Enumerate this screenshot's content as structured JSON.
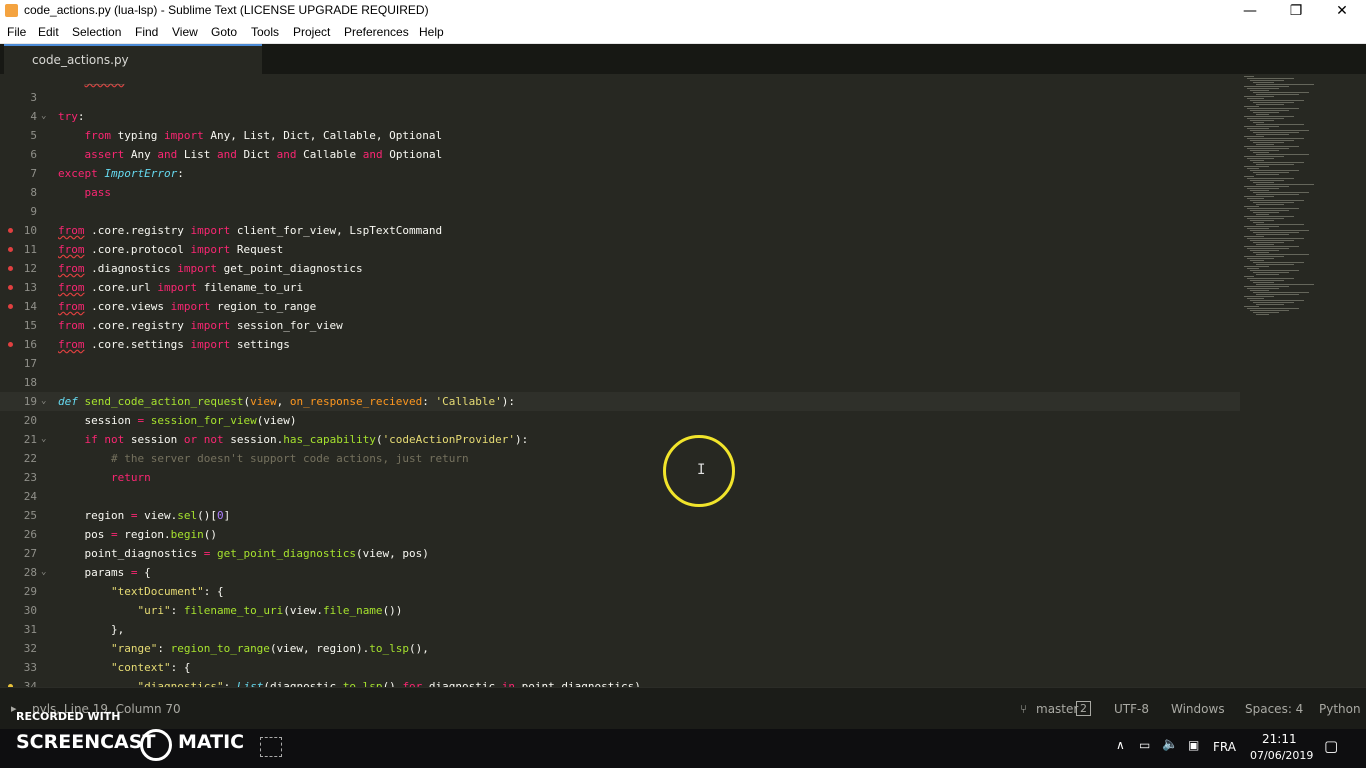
{
  "window": {
    "title": "code_actions.py (lua-lsp) - Sublime Text (LICENSE UPGRADE REQUIRED)",
    "minimize": "—",
    "restore": "❐",
    "close": "✕"
  },
  "menu": [
    "File",
    "Edit",
    "Selection",
    "Find",
    "View",
    "Goto",
    "Tools",
    "Project",
    "Preferences",
    "Help"
  ],
  "tab": {
    "label": "code_actions.py"
  },
  "lines": [
    {
      "n": "",
      "html": "<span class='c'>    </span><span class='sq c'>______</span>",
      "fold": "",
      "mark": ""
    },
    {
      "n": "3",
      "html": "",
      "fold": "",
      "mark": ""
    },
    {
      "n": "4",
      "html": "<span class='k'>try</span><span class='t'>:</span>",
      "fold": "⌄",
      "mark": ""
    },
    {
      "n": "5",
      "html": "<span class='t'>    </span><span class='k'>from</span><span class='t'> typing </span><span class='k'>import</span><span class='t'> Any, List, Dict, Callable, Optional</span>",
      "fold": "",
      "mark": ""
    },
    {
      "n": "6",
      "html": "<span class='t'>    </span><span class='k'>assert</span><span class='t'> Any </span><span class='k'>and</span><span class='t'> List </span><span class='k'>and</span><span class='t'> Dict </span><span class='k'>and</span><span class='t'> Callable </span><span class='k'>and</span><span class='t'> Optional</span>",
      "fold": "",
      "mark": ""
    },
    {
      "n": "7",
      "html": "<span class='k'>except</span><span class='t'> </span><span class='b'>ImportError</span><span class='t'>:</span>",
      "fold": "",
      "mark": ""
    },
    {
      "n": "8",
      "html": "<span class='t'>    </span><span class='k'>pass</span>",
      "fold": "",
      "mark": ""
    },
    {
      "n": "9",
      "html": "",
      "fold": "",
      "mark": ""
    },
    {
      "n": "10",
      "html": "<span class='k sq'>from</span><span class='t'> .core.registry </span><span class='k'>import</span><span class='t'> client_for_view, LspTextCommand</span>",
      "fold": "",
      "mark": "err"
    },
    {
      "n": "11",
      "html": "<span class='k sq'>from</span><span class='t'> .core.protocol </span><span class='k'>import</span><span class='t'> Request</span>",
      "fold": "",
      "mark": "err"
    },
    {
      "n": "12",
      "html": "<span class='k sq'>from</span><span class='t'> .diagnostics </span><span class='k'>import</span><span class='t'> get_point_diagnostics</span>",
      "fold": "",
      "mark": "err"
    },
    {
      "n": "13",
      "html": "<span class='k sq'>from</span><span class='t'> .core.url </span><span class='k'>import</span><span class='t'> filename_to_uri</span>",
      "fold": "",
      "mark": "err"
    },
    {
      "n": "14",
      "html": "<span class='k sq'>from</span><span class='t'> .core.views </span><span class='k'>import</span><span class='t'> region_to_range</span>",
      "fold": "",
      "mark": "err"
    },
    {
      "n": "15",
      "html": "<span class='k'>from</span><span class='t'> .core.registry </span><span class='k'>import</span><span class='t'> session_for_view</span>",
      "fold": "",
      "mark": ""
    },
    {
      "n": "16",
      "html": "<span class='k sq'>from</span><span class='t'> .core.settings </span><span class='k'>import</span><span class='t'> settings</span>",
      "fold": "",
      "mark": "err"
    },
    {
      "n": "17",
      "html": "",
      "fold": "",
      "mark": ""
    },
    {
      "n": "18",
      "html": "",
      "fold": "",
      "mark": ""
    },
    {
      "n": "19",
      "html": "<span class='b'>def</span><span class='t'> </span><span class='f'>send_code_action_request</span><span class='t'>(</span><span class='e'>view</span><span class='t'>, </span><span class='e'>on_response_recieved</span><span class='t'>: </span><span class='s'>'Callable'</span><span class='t'>):</span>",
      "fold": "⌄",
      "mark": "",
      "active": true
    },
    {
      "n": "20",
      "html": "<span class='t'>    session </span><span class='k'>=</span><span class='t'> </span><span class='f'>session_for_view</span><span class='t'>(view)</span>",
      "fold": "",
      "mark": ""
    },
    {
      "n": "21",
      "html": "<span class='t'>    </span><span class='k'>if</span><span class='t'> </span><span class='k'>not</span><span class='t'> session </span><span class='k'>or</span><span class='t'> </span><span class='k'>not</span><span class='t'> session.</span><span class='f'>has_capability</span><span class='t'>(</span><span class='s'>'codeActionProvider'</span><span class='t'>):</span>",
      "fold": "⌄",
      "mark": ""
    },
    {
      "n": "22",
      "html": "<span class='c'>        # the server doesn't support code actions, just return</span>",
      "fold": "",
      "mark": ""
    },
    {
      "n": "23",
      "html": "<span class='t'>        </span><span class='k'>return</span>",
      "fold": "",
      "mark": ""
    },
    {
      "n": "24",
      "html": "",
      "fold": "",
      "mark": ""
    },
    {
      "n": "25",
      "html": "<span class='t'>    region </span><span class='k'>=</span><span class='t'> view.</span><span class='f'>sel</span><span class='t'>()[</span><span class='n'>0</span><span class='t'>]</span>",
      "fold": "",
      "mark": ""
    },
    {
      "n": "26",
      "html": "<span class='t'>    pos </span><span class='k'>=</span><span class='t'> region.</span><span class='f'>begin</span><span class='t'>()</span>",
      "fold": "",
      "mark": ""
    },
    {
      "n": "27",
      "html": "<span class='t'>    point_diagnostics </span><span class='k'>=</span><span class='t'> </span><span class='f'>get_point_diagnostics</span><span class='t'>(view, pos)</span>",
      "fold": "",
      "mark": ""
    },
    {
      "n": "28",
      "html": "<span class='t'>    params </span><span class='k'>=</span><span class='t'> {</span>",
      "fold": "⌄",
      "mark": ""
    },
    {
      "n": "29",
      "html": "<span class='t'>        </span><span class='s'>\"textDocument\"</span><span class='t'>: {</span>",
      "fold": "",
      "mark": ""
    },
    {
      "n": "30",
      "html": "<span class='t'>            </span><span class='s'>\"uri\"</span><span class='t'>: </span><span class='f'>filename_to_uri</span><span class='t'>(view.</span><span class='f'>file_name</span><span class='t'>())</span>",
      "fold": "",
      "mark": ""
    },
    {
      "n": "31",
      "html": "<span class='t'>        },</span>",
      "fold": "",
      "mark": ""
    },
    {
      "n": "32",
      "html": "<span class='t'>        </span><span class='s'>\"range\"</span><span class='t'>: </span><span class='f'>region_to_range</span><span class='t'>(view, region).</span><span class='f'>to_lsp</span><span class='t'>(),</span>",
      "fold": "",
      "mark": ""
    },
    {
      "n": "33",
      "html": "<span class='t'>        </span><span class='s'>\"context\"</span><span class='t'>: {</span>",
      "fold": "",
      "mark": ""
    },
    {
      "n": "34",
      "html": "<span class='t'>            </span><span class='s'>\"diagnostics\"</span><span class='t'>: </span><span class='b'>List</span><span class='t'>(diagnostic.</span><span class='f'>to_lsp</span><span class='t'>() </span><span class='k'>for</span><span class='t'> diagnostic </span><span class='k'>in</span><span class='t'> </span><span class='sq t'>point_diagnostics)</span>",
      "fold": "",
      "mark": "warn"
    }
  ],
  "status": {
    "left": "pyls, Line 19, Column 70",
    "branch": "master",
    "branch_count": "2",
    "encoding": "UTF-8",
    "line_endings": "Windows",
    "indent": "Spaces: 4",
    "syntax": "Python"
  },
  "watermark": {
    "recorded": "RECORDED WITH",
    "brand": "SCREENCAST",
    "brand2": "MATIC"
  },
  "taskbar": {
    "lang": "FRA",
    "time": "21:11",
    "date": "07/06/2019"
  },
  "colors": {
    "keyword": "#f92672",
    "function": "#a6e22e",
    "string": "#e6db74",
    "comment": "#75715e",
    "accent": "#4c8bd6",
    "cursor_ring": "#f1e42b"
  }
}
